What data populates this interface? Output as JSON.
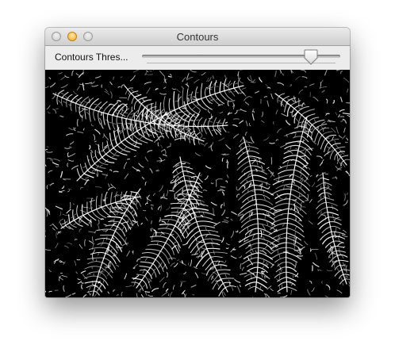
{
  "window": {
    "title": "Contours"
  },
  "trackbar": {
    "label": "Contours Thres...",
    "value_fraction": 0.88
  },
  "image": {
    "icon": "contour-image",
    "background": "#000000",
    "line_color": "#ffffff"
  },
  "colors": {
    "minimize": "#f2a51f",
    "close": "#c8c8c8",
    "zoom": "#c8c8c8"
  }
}
